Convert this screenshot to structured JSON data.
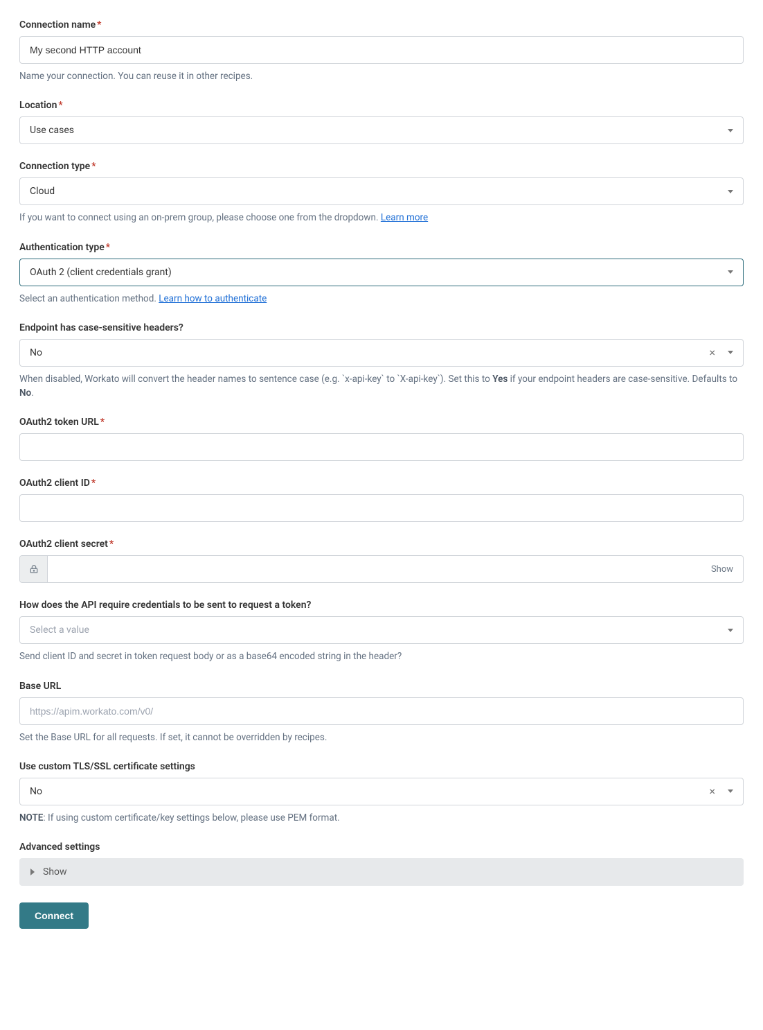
{
  "connectionName": {
    "label": "Connection name",
    "value": "My second HTTP account",
    "helper": "Name your connection. You can reuse it in other recipes."
  },
  "location": {
    "label": "Location",
    "value": "Use cases"
  },
  "connectionType": {
    "label": "Connection type",
    "value": "Cloud",
    "helperPrefix": "If you want to connect using an on-prem group, please choose one from the dropdown. ",
    "helperLink": "Learn more"
  },
  "authType": {
    "label": "Authentication type",
    "value": "OAuth 2 (client credentials grant)",
    "helperPrefix": "Select an authentication method. ",
    "helperLink": "Learn how to authenticate"
  },
  "caseSensitive": {
    "label": "Endpoint has case-sensitive headers?",
    "value": "No",
    "helperA": "When disabled, Workato will convert the header names to sentence case (e.g. `x-api-key` to `X-api-key`). Set this to ",
    "helperYes": "Yes",
    "helperB": " if your endpoint headers are case-sensitive. Defaults to ",
    "helperNo": "No",
    "helperC": "."
  },
  "tokenUrl": {
    "label": "OAuth2 token URL",
    "value": ""
  },
  "clientId": {
    "label": "OAuth2 client ID",
    "value": ""
  },
  "clientSecret": {
    "label": "OAuth2 client secret",
    "value": "",
    "show": "Show"
  },
  "credentialsMethod": {
    "label": "How does the API require credentials to be sent to request a token?",
    "placeholder": "Select a value",
    "helper": "Send client ID and secret in token request body or as a base64 encoded string in the header?"
  },
  "baseUrl": {
    "label": "Base URL",
    "placeholder": "https://apim.workato.com/v0/",
    "helper": "Set the Base URL for all requests. If set, it cannot be overridden by recipes."
  },
  "tls": {
    "label": "Use custom TLS/SSL certificate settings",
    "value": "No",
    "noteLabel": "NOTE",
    "noteText": ": If using custom certificate/key settings below, please use PEM format."
  },
  "advanced": {
    "label": "Advanced settings",
    "show": "Show"
  },
  "connectBtn": "Connect"
}
